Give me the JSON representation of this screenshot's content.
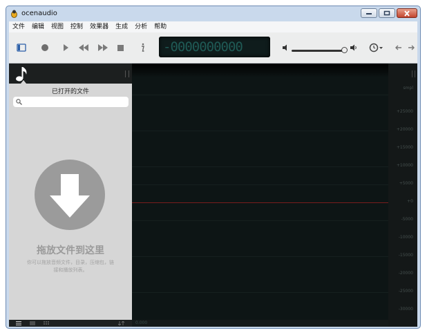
{
  "window": {
    "title": "ocenaudio"
  },
  "menu": [
    "文件",
    "编辑",
    "视图",
    "控制",
    "效果器",
    "生成",
    "分析",
    "帮助"
  ],
  "toolbar": {
    "time_display": "-0000000000"
  },
  "sidebar": {
    "title": "已打开的文件",
    "search_placeholder": "",
    "drop_title": "拖放文件到这里",
    "drop_desc": "你可以拖放音频文件，目录，压缩包，链接和播放列表。"
  },
  "waveform": {
    "start_time": "0.000",
    "scale_unit": "smpl",
    "scale_labels": [
      "+25000",
      "+20000",
      "+15000",
      "+10000",
      "+5000",
      "+0",
      "-5000",
      "-10000",
      "-15000",
      "-20000",
      "-25000",
      "-30000"
    ]
  },
  "colors": {
    "accent": "#2a5ea8",
    "lcd_digits": "#1f5a55",
    "zero_line": "#7a1d1d"
  }
}
